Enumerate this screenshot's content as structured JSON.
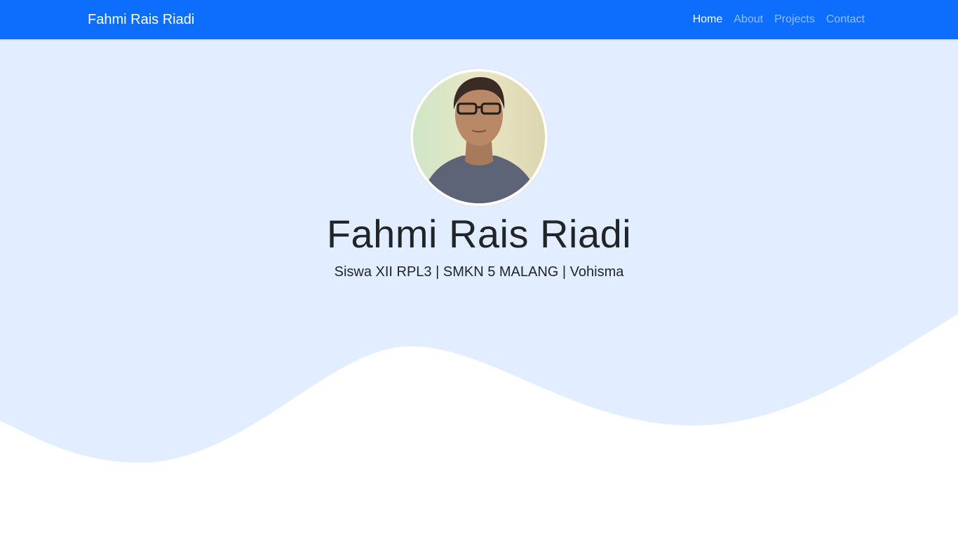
{
  "navbar": {
    "brand": "Fahmi Rais Riadi",
    "links": [
      {
        "label": "Home",
        "active": true
      },
      {
        "label": "About",
        "active": false
      },
      {
        "label": "Projects",
        "active": false
      },
      {
        "label": "Contact",
        "active": false
      }
    ]
  },
  "hero": {
    "name": "Fahmi Rais Riadi",
    "subtitle": "Siswa XII RPL3 | SMKN 5 MALANG | Vohisma"
  },
  "colors": {
    "navbar": "#0d6efd",
    "hero_background": "#e2edff",
    "text": "#212529"
  }
}
